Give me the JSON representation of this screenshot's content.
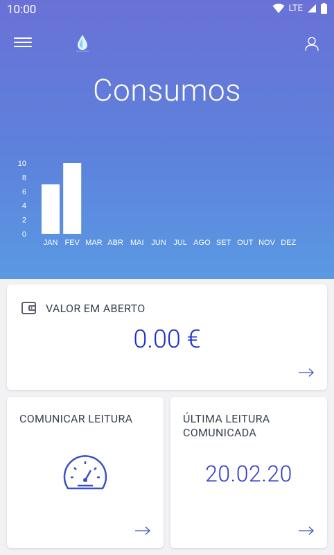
{
  "status_bar": {
    "time": "10:00",
    "network": "LTE",
    "icons": [
      "wifi-icon",
      "signal-icon",
      "battery-icon"
    ]
  },
  "header": {
    "menu_icon": "hamburger-menu-icon",
    "logo_icon": "water-drop-logo",
    "profile_icon": "user-profile-icon",
    "title": "Consumos"
  },
  "colors": {
    "gradient_top": "#6a71d6",
    "gradient_bottom": "#5a99e2",
    "accent_blue": "#1d2ec9",
    "card_text": "#39414f",
    "icon_stroke": "#3a51c4"
  },
  "chart_data": {
    "type": "bar",
    "categories": [
      "JAN",
      "FEV",
      "MAR",
      "ABR",
      "MAI",
      "JUN",
      "JUL",
      "AGO",
      "SET",
      "OUT",
      "NOV",
      "DEZ"
    ],
    "values": [
      7,
      10,
      0,
      0,
      0,
      0,
      0,
      0,
      0,
      0,
      0,
      0
    ],
    "yticks": [
      "0",
      "2",
      "4",
      "6",
      "8",
      "10"
    ],
    "ylim": [
      0,
      10
    ],
    "title": "",
    "xlabel": "",
    "ylabel": "",
    "grid": false,
    "bar_color": "#ffffff"
  },
  "open_value_card": {
    "icon": "wallet-icon",
    "label": "VALOR EM ABERTO",
    "amount": "0.00 €",
    "arrow_icon": "arrow-right-icon"
  },
  "submit_reading_card": {
    "label": "COMUNICAR LEITURA",
    "icon": "speedometer-icon",
    "arrow_icon": "arrow-right-icon"
  },
  "last_reading_card": {
    "label": "ÚLTIMA LEITURA COMUNICADA",
    "date": "20.02.20",
    "arrow_icon": "arrow-right-icon"
  }
}
